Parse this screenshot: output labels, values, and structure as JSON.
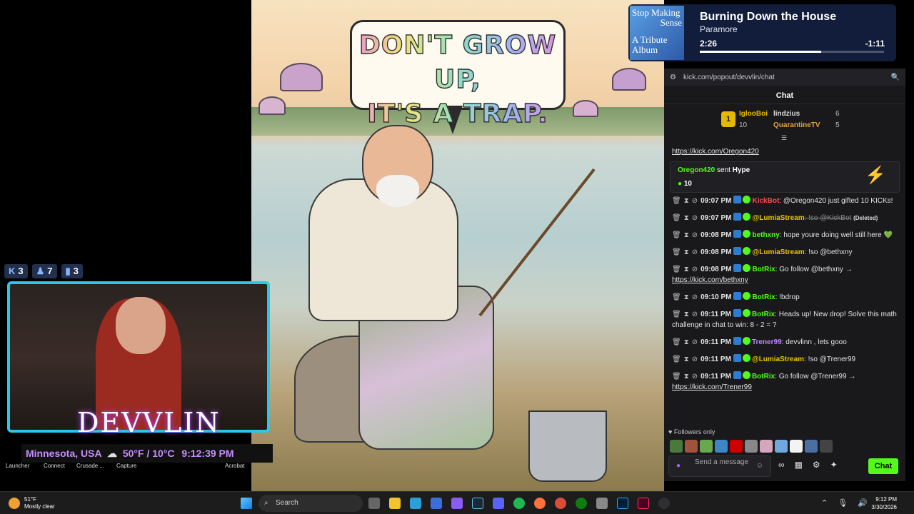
{
  "artwork": {
    "line1": "DON'T GROW UP,",
    "line2": "IT'S A TRAP."
  },
  "now_playing": {
    "album_lines": [
      "Stop Making",
      "Sense",
      "A Tribute",
      "Album"
    ],
    "title": "Burning Down the House",
    "artist": "Paramore",
    "elapsed": "2:26",
    "remaining": "-1:11",
    "progress": 0.66
  },
  "browser": {
    "url": "kick.com/popout/devvlin/chat"
  },
  "chat": {
    "header": "Chat",
    "leaderboard": [
      {
        "rank": "1",
        "name": "IglooBoi",
        "value": "10"
      },
      {
        "name": "lindzius",
        "value": "6"
      },
      {
        "name": "QuarantineTV",
        "value": "5"
      }
    ],
    "top_link": "https://kick.com/Oregon420",
    "hype": {
      "user": "Oregon420",
      "verb": "sent",
      "item": "Hype",
      "value": "10"
    },
    "messages": [
      {
        "time": "09:07 PM",
        "user": "KickBot",
        "color": "#ff4d4d",
        "text": ": @Oregon420 just gifted 10 KICKs!"
      },
      {
        "time": "09:07 PM",
        "user": "@LumiaStream",
        "color": "#e6c300",
        "text": ": !so @KickBot",
        "note": "(Deleted)",
        "deleted": true
      },
      {
        "time": "09:08 PM",
        "user": "bethxny",
        "color": "#53fc18",
        "text": ": hope youre doing well still here 💚"
      },
      {
        "time": "09:08 PM",
        "user": "@LumiaStream",
        "color": "#e6c300",
        "text": ": !so @bethxny"
      },
      {
        "time": "09:08 PM",
        "user": "BotRix",
        "color": "#53fc18",
        "text": ": Go follow @bethxny →",
        "link": "https://kick.com/bethxny"
      },
      {
        "time": "09:10 PM",
        "user": "BotRix",
        "color": "#53fc18",
        "text": ": !bdrop"
      },
      {
        "time": "09:11 PM",
        "user": "BotRix",
        "color": "#53fc18",
        "text": ": Heads up! New drop! Solve this math challenge in chat to win: 8 - 2 = ?"
      },
      {
        "time": "09:11 PM",
        "user": "Trener99",
        "color": "#c084fc",
        "text": ": devvlinn , lets gooo"
      },
      {
        "time": "09:11 PM",
        "user": "@LumiaStream",
        "color": "#e6c300",
        "text": ": !so @Trener99"
      },
      {
        "time": "09:11 PM",
        "user": "BotRix",
        "color": "#53fc18",
        "text": ": Go follow @Trener99 →",
        "link": "https://kick.com/Trener99"
      }
    ],
    "followers_only": "Followers only",
    "input_placeholder": "Send a message",
    "send_label": "Chat"
  },
  "stream": {
    "badges": [
      "3",
      "7",
      "3"
    ],
    "logo": "DEVVLIN",
    "location": "Minnesota, USA",
    "weather": "50°F / 10°C",
    "time": "9:12:39 PM"
  },
  "desktop_icons": [
    "Launcher",
    "Connect",
    "Crusade ...",
    "Capture",
    "Acrobat"
  ],
  "taskbar": {
    "temp": "51°F",
    "condition": "Mostly clear",
    "search": "Search",
    "clock_time": "9:12 PM",
    "clock_date": "3/30/2026"
  }
}
